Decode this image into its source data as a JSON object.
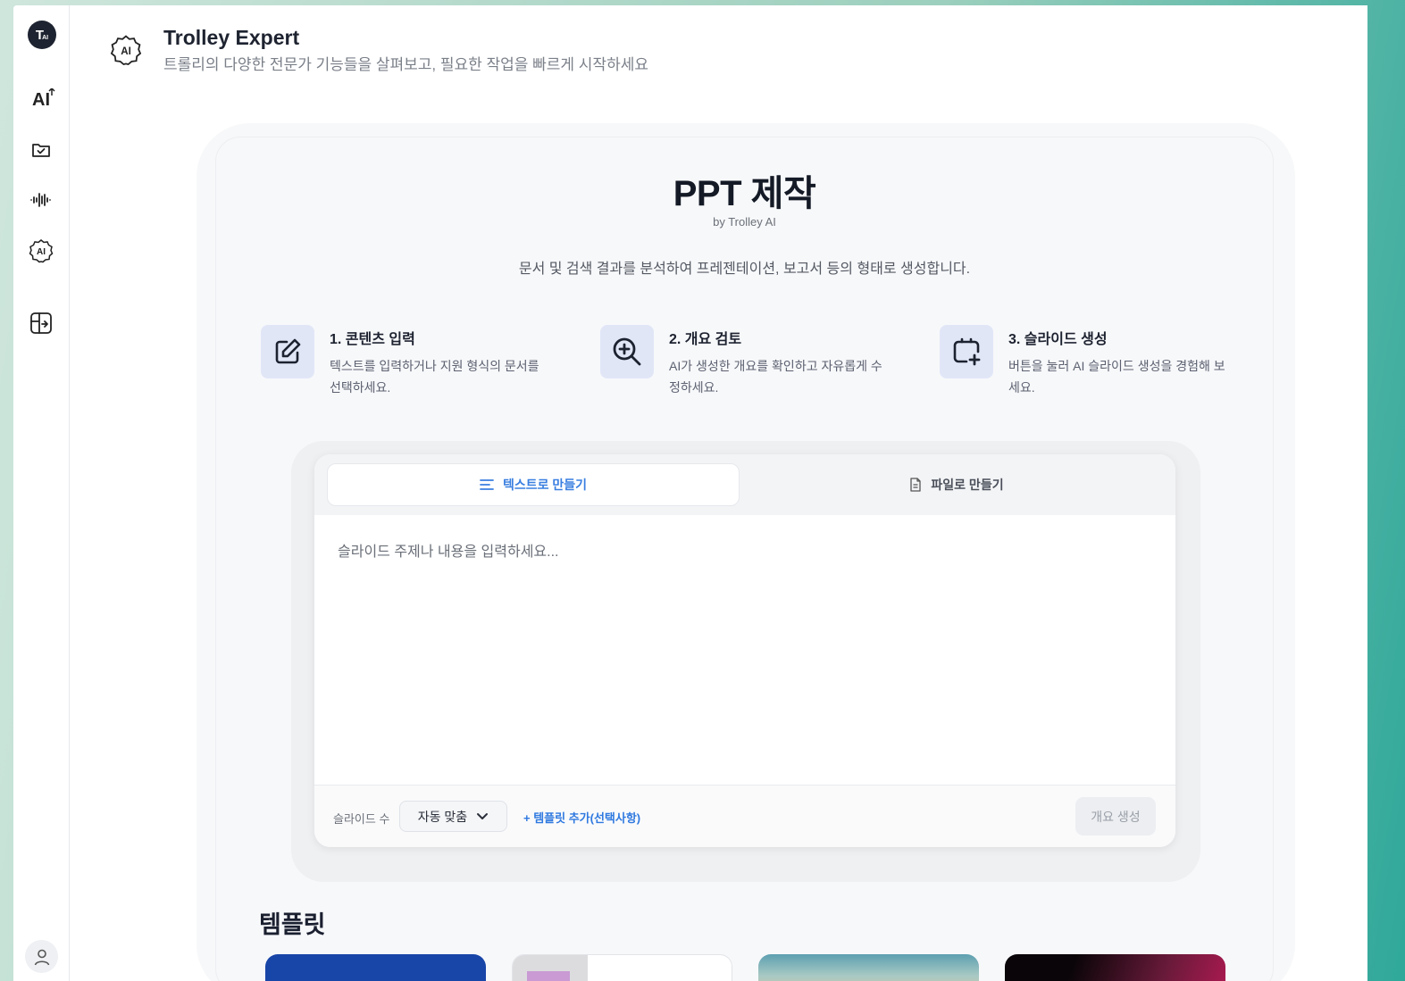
{
  "app": {
    "logo_text": "T",
    "logo_sub": "AI",
    "title": "Trolley Expert",
    "subtitle": "트롤리의 다양한 전문가 기능들을 살펴보고, 필요한 작업을 빠르게 시작하세요"
  },
  "sidebar": {
    "items": [
      {
        "icon": "ai-sparkle-icon",
        "text": "AI"
      },
      {
        "icon": "folder-check-icon"
      },
      {
        "icon": "audio-wave-icon"
      },
      {
        "icon": "ai-badge-icon"
      },
      {
        "icon": "panel-enter-icon"
      }
    ]
  },
  "page": {
    "title": "PPT 제작",
    "by": "by Trolley AI",
    "description": "문서 및 검색 결과를 분석하여 프레젠테이션, 보고서 등의 형태로 생성합니다."
  },
  "steps": [
    {
      "title": "1. 콘텐츠 입력",
      "desc": "텍스트를 입력하거나 지원 형식의 문서를 선택하세요.",
      "icon": "edit-icon"
    },
    {
      "title": "2. 개요 검토",
      "desc": "AI가 생성한 개요를 확인하고 자유롭게 수정하세요.",
      "icon": "zoom-in-icon"
    },
    {
      "title": "3. 슬라이드 생성",
      "desc": "버튼을 눌러 AI 슬라이드 생성을 경험해 보세요.",
      "icon": "slide-add-icon"
    }
  ],
  "input": {
    "tabs": [
      {
        "label": "텍스트로 만들기",
        "icon": "text-lines-icon",
        "active": true
      },
      {
        "label": "파일로 만들기",
        "icon": "file-icon",
        "active": false
      }
    ],
    "placeholder": "슬라이드 주제나 내용을 입력하세요...",
    "value": "",
    "slide_count_label": "슬라이드 수",
    "slide_count_value": "자동 맞춤",
    "template_link": "+ 템플릿 추가(선택사항)",
    "generate_button": "개요 생성"
  },
  "templates": {
    "title": "템플릿"
  },
  "colors": {
    "accent": "#2f79e0",
    "step_icon_bg": "#e1e6f7",
    "sidebar_border": "#e6e8ec"
  }
}
